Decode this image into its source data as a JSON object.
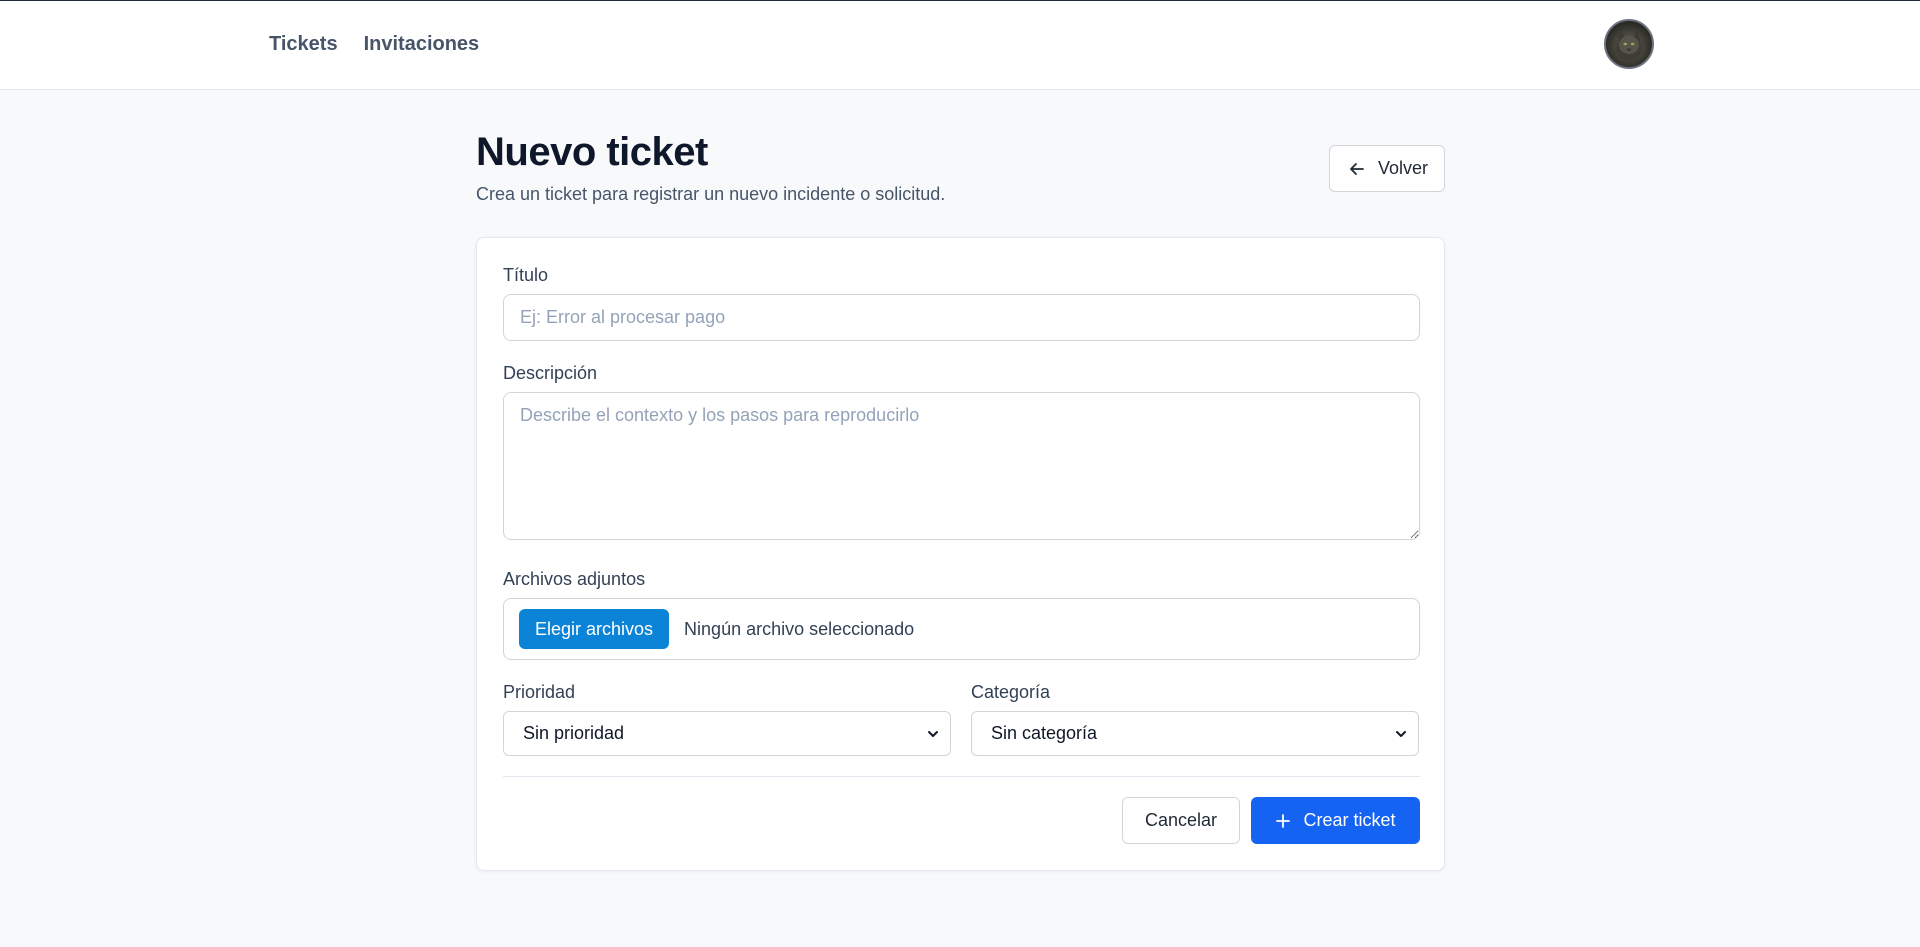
{
  "nav": {
    "items": [
      {
        "label": "Tickets"
      },
      {
        "label": "Invitaciones"
      }
    ]
  },
  "header": {
    "title": "Nuevo ticket",
    "subtitle": "Crea un ticket para registrar un nuevo incidente o solicitud.",
    "back_label": "Volver"
  },
  "form": {
    "title": {
      "label": "Título",
      "placeholder": "Ej: Error al procesar pago",
      "value": ""
    },
    "description": {
      "label": "Descripción",
      "placeholder": "Describe el contexto y los pasos para reproducirlo",
      "value": ""
    },
    "attachments": {
      "label": "Archivos adjuntos",
      "button_label": "Elegir archivos",
      "status": "Ningún archivo seleccionado"
    },
    "priority": {
      "label": "Prioridad",
      "selected": "Sin prioridad"
    },
    "category": {
      "label": "Categoría",
      "selected": "Sin categoría"
    },
    "cancel_label": "Cancelar",
    "submit_label": "Crear ticket"
  },
  "icons": {
    "back": "arrow-left-icon",
    "plus": "plus-icon",
    "chevron": "chevron-down-icon",
    "avatar": "cat-avatar"
  },
  "colors": {
    "primary": "#1463f3",
    "file_button": "#0b84d8",
    "background": "#f8f9fb"
  }
}
